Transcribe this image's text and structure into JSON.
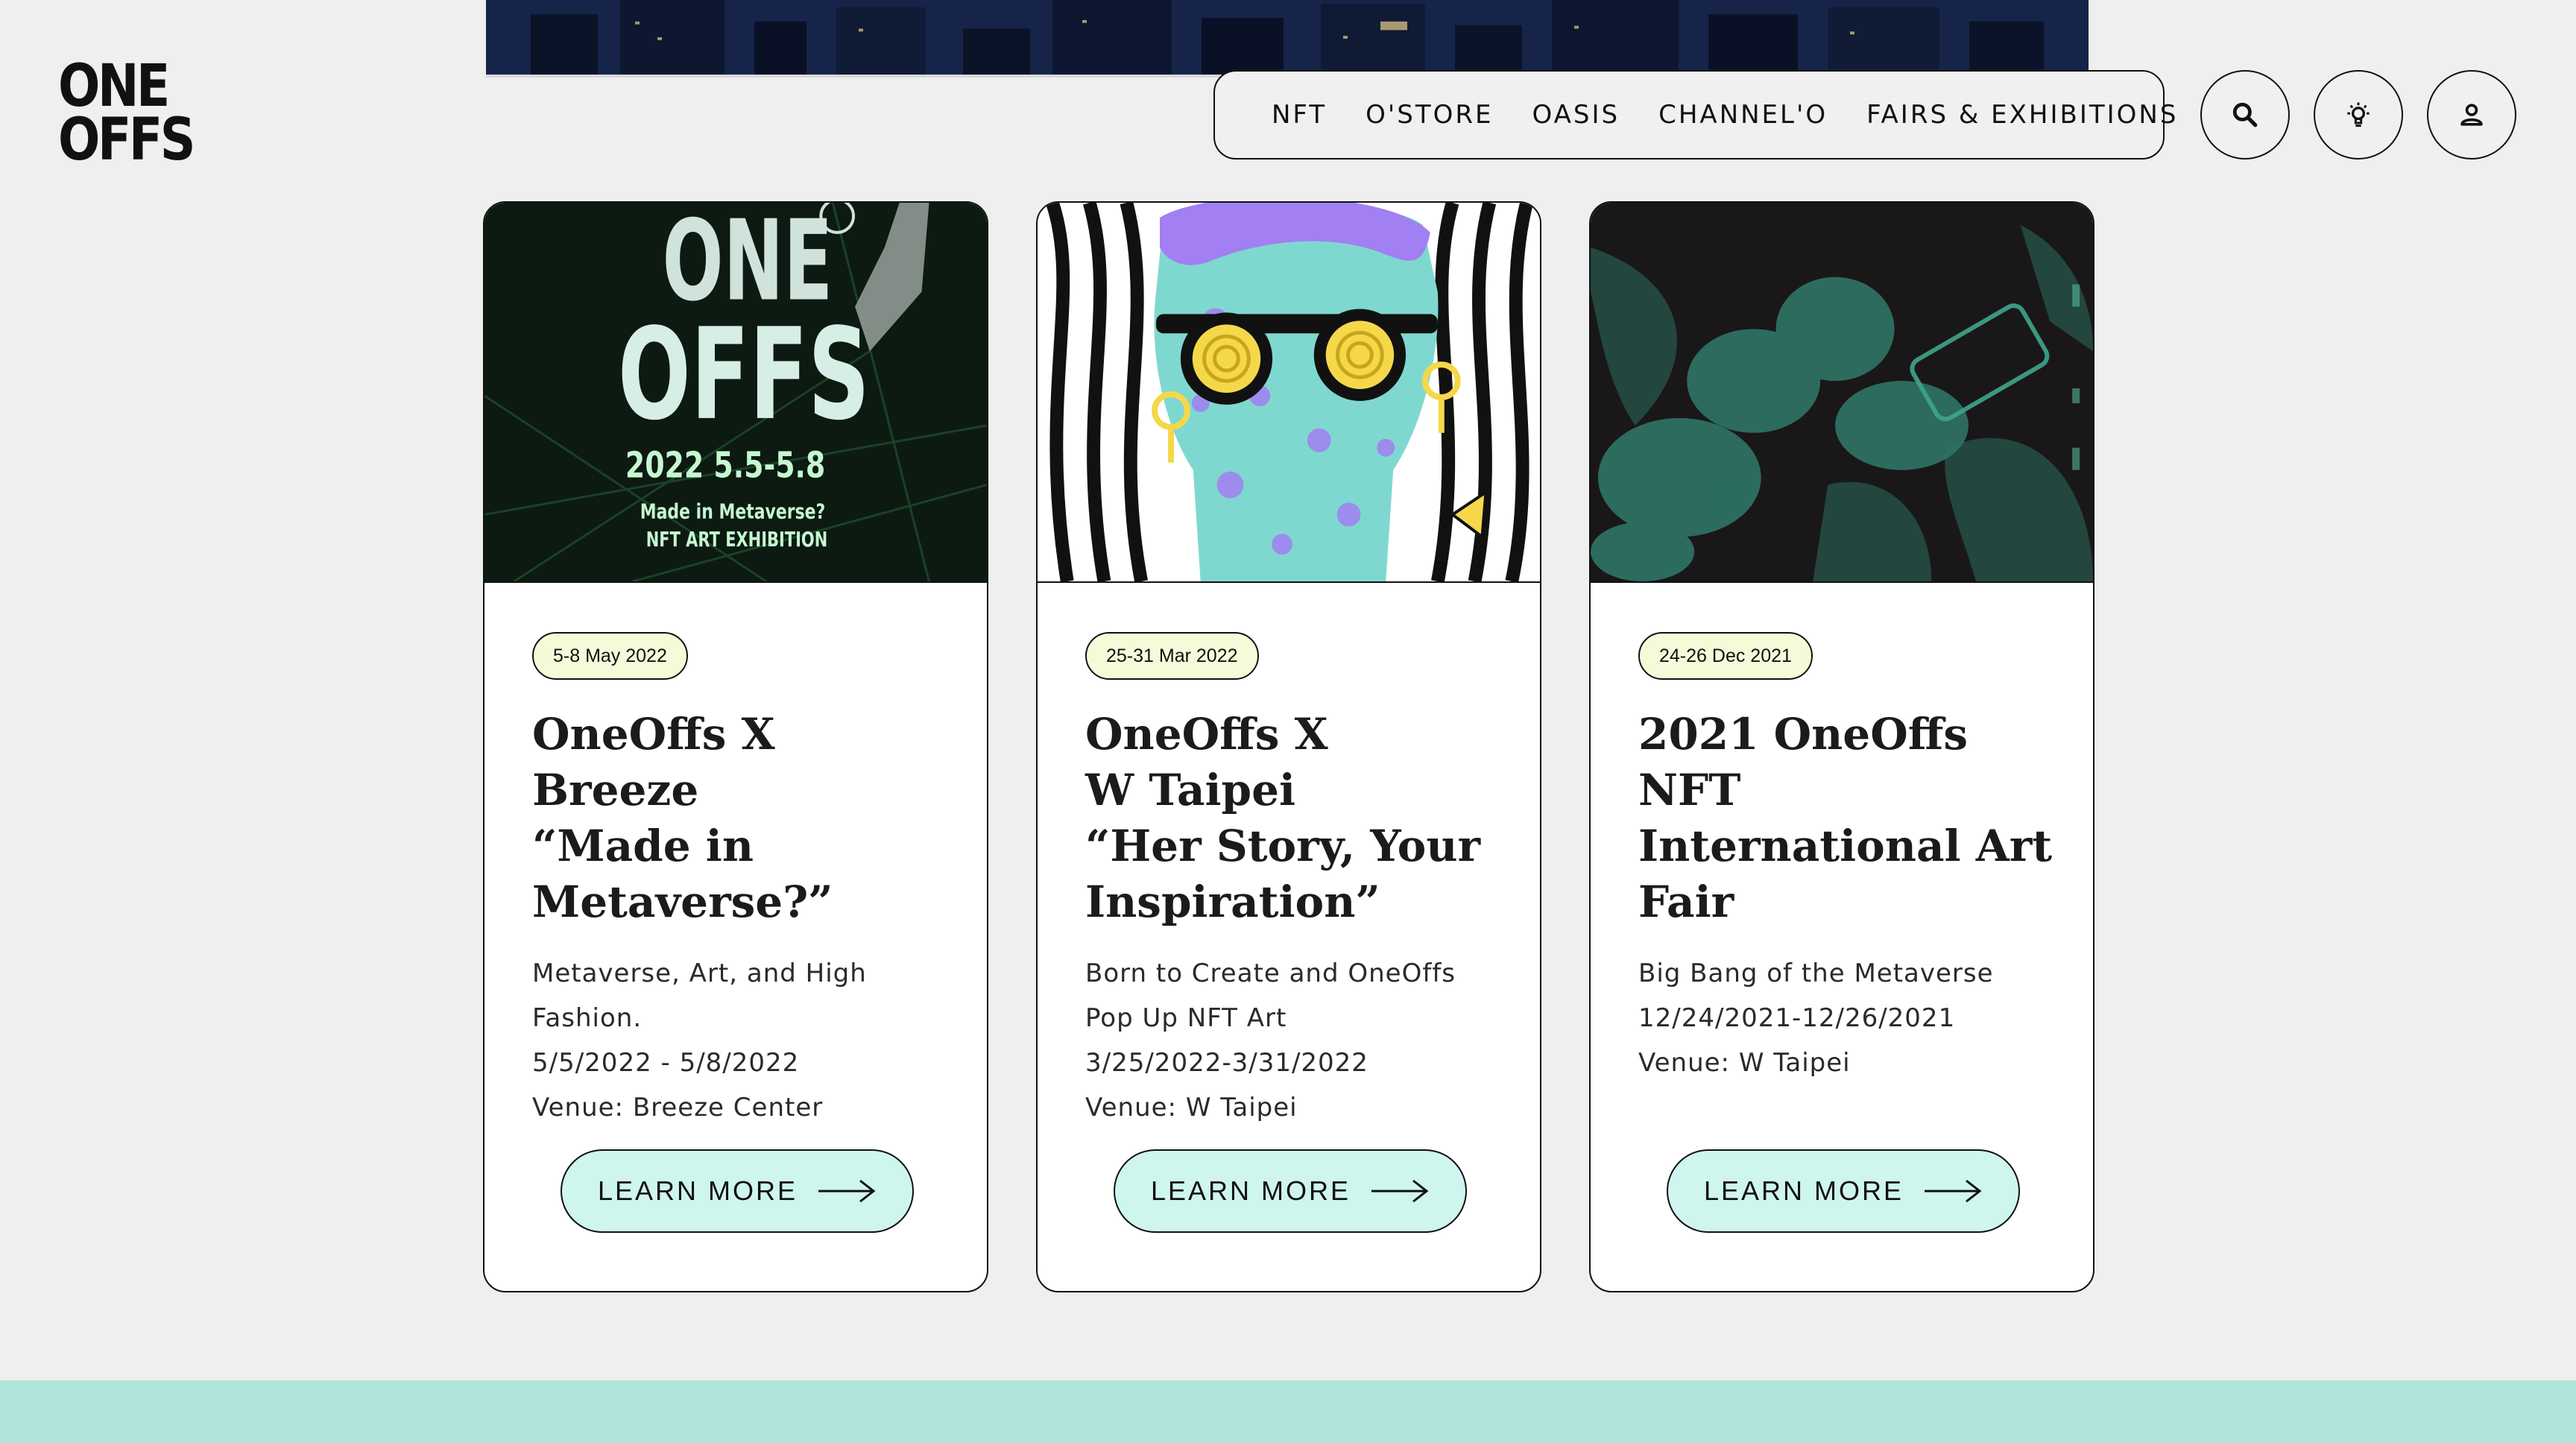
{
  "logo": {
    "line1": "ONE",
    "line2": "OFFS"
  },
  "nav": {
    "items": [
      "NFT",
      "O'STORE",
      "OASIS",
      "CHANNEL'O",
      "FAIRS & EXHIBITIONS"
    ]
  },
  "header_buttons": {
    "search": "search-icon",
    "theme": "light-bulb-icon",
    "account": "user-icon"
  },
  "cards": [
    {
      "date": "5-8 May 2022",
      "title": "OneOffs X Breeze\n“Made in\nMetaverse?”",
      "desc": "Metaverse, Art, and High\nFashion.\n5/5/2022 - 5/8/2022\nVenue: Breeze Center",
      "button": "LEARN MORE",
      "image_text": {
        "logo_line1": "ONE",
        "logo_line2": "OFFS",
        "dates": "2022 5.5-5.8",
        "line1": "Made in Metaverse?",
        "line2": "NFT ART EXHIBITION"
      }
    },
    {
      "date": "25-31 Mar 2022",
      "title": "OneOffs X\nW Taipei\n“Her Story, Your\nInspiration”",
      "desc": "Born to Create and OneOffs\nPop Up NFT Art\n3/25/2022-3/31/2022\nVenue: W Taipei",
      "button": "LEARN MORE"
    },
    {
      "date": "24-26 Dec 2021",
      "title": "2021 OneOffs NFT\nInternational Art\nFair",
      "desc": "Big Bang of the Metaverse\n12/24/2021-12/26/2021\nVenue: W Taipei",
      "button": "LEARN MORE"
    }
  ],
  "colors": {
    "page_bg": "#efefef",
    "badge_bg": "#f4fbd9",
    "button_bg": "#cff5ef",
    "footer_band": "#b0e3da"
  }
}
